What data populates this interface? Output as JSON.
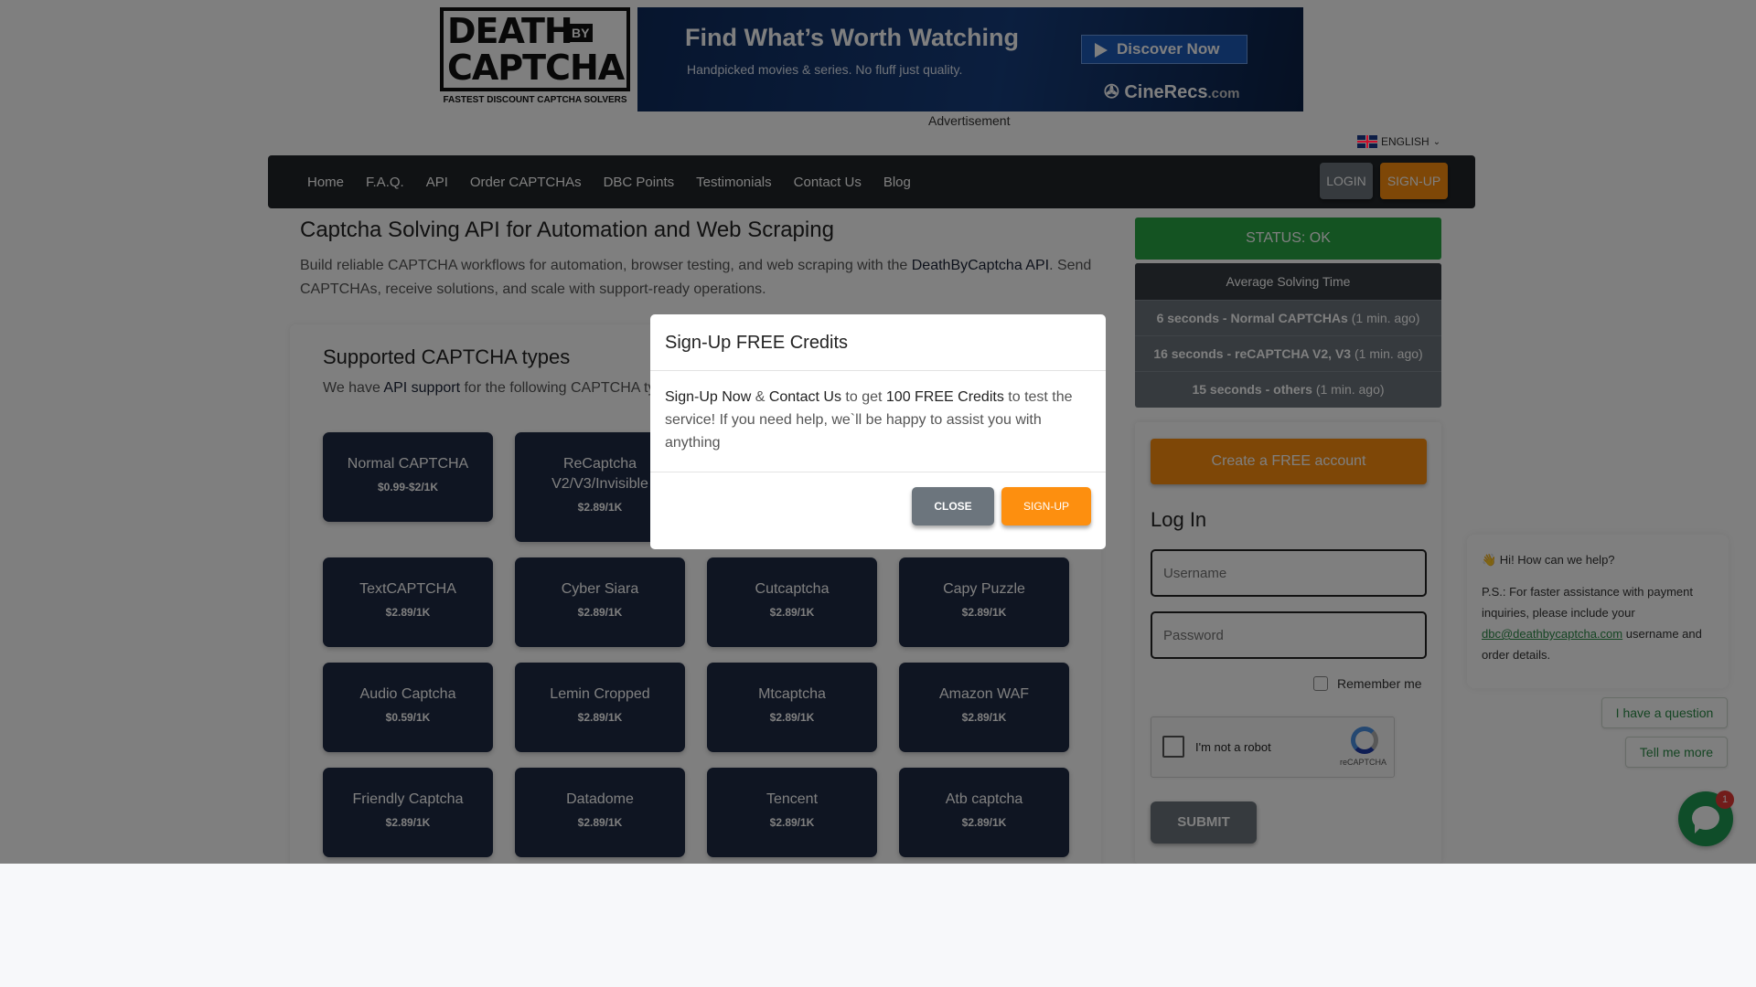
{
  "header": {
    "logo": {
      "line1": "DEATH",
      "by": "BY",
      "line2": "CAPTCHA",
      "tagline": "FASTEST DISCOUNT CAPTCHA SOLVERS"
    },
    "ad": {
      "headline": "Find What’s Worth Watching",
      "sub": "Handpicked movies & series. No fluff just quality.",
      "button": "Discover Now",
      "brand": "CineRecs",
      "brand_suffix": ".com",
      "label": "Advertisement"
    },
    "language": "ENGLISH"
  },
  "nav": {
    "items": [
      "Home",
      "F.A.Q.",
      "API",
      "Order CAPTCHAs",
      "DBC Points",
      "Testimonials",
      "Contact Us",
      "Blog"
    ],
    "login": "LOGIN",
    "signup": "SIGN-UP"
  },
  "main": {
    "title": "Captcha Solving API for Automation and Web Scraping",
    "intro_pre": "Build reliable CAPTCHA workflows for automation, browser testing, and web scraping with the ",
    "intro_link": "DeathByCaptcha API",
    "intro_post": ". Send CAPTCHAs, receive solutions, and scale with support-ready operations.",
    "types_title": "Supported CAPTCHA types",
    "types_sub_pre": "We have ",
    "types_sub_link": "API support",
    "types_sub_post": " for the following CAPTCHA ty",
    "tiles": [
      {
        "name": "Normal CAPTCHA",
        "price": "$0.99-$2/1K"
      },
      {
        "name": "ReCaptcha V2/V3/Invisible",
        "price": "$2.89/1K"
      },
      {
        "name": "TextCAPTCHA",
        "price": "$2.89/1K"
      },
      {
        "name": "Cyber Siara",
        "price": "$2.89/1K"
      },
      {
        "name": "Cutcaptcha",
        "price": "$2.89/1K"
      },
      {
        "name": "Capy Puzzle",
        "price": "$2.89/1K"
      },
      {
        "name": "Audio Captcha",
        "price": "$0.59/1K"
      },
      {
        "name": "Lemin Cropped",
        "price": "$2.89/1K"
      },
      {
        "name": "Mtcaptcha",
        "price": "$2.89/1K"
      },
      {
        "name": "Amazon WAF",
        "price": "$2.89/1K"
      },
      {
        "name": "Friendly Captcha",
        "price": "$2.89/1K"
      },
      {
        "name": "Datadome",
        "price": "$2.89/1K"
      },
      {
        "name": "Tencent",
        "price": "$2.89/1K"
      },
      {
        "name": "Atb captcha",
        "price": "$2.89/1K"
      }
    ]
  },
  "sidebar": {
    "status": "STATUS: OK",
    "avg_title": "Average Solving Time",
    "avg_rows": [
      {
        "label": "6 seconds - Normal CAPTCHAs",
        "ago": "(1 min. ago)"
      },
      {
        "label": "16 seconds - reCAPTCHA V2, V3",
        "ago": "(1 min. ago)"
      },
      {
        "label": "15 seconds - others",
        "ago": "(1 min. ago)"
      }
    ],
    "create_account": "Create a FREE account",
    "login_title": "Log In",
    "username_placeholder": "Username",
    "password_placeholder": "Password",
    "remember": "Remember me",
    "recaptcha_text": "I'm not a robot",
    "recaptcha_label": "reCAPTCHA",
    "submit": "SUBMIT"
  },
  "chat": {
    "greeting": "👋 Hi! How can we help?",
    "ps_pre": "P.S.: For faster assistance with payment inquiries, please include your ",
    "ps_mail": "dbc@deathbycaptcha.com",
    "ps_post": " username and order details.",
    "quick1": "I have a question",
    "quick2": "Tell me more",
    "badge": "1"
  },
  "modal": {
    "title": "Sign-Up FREE Credits",
    "body_link1": "Sign-Up Now",
    "body_amp": " & ",
    "body_link2": "Contact Us",
    "body_mid": " to get ",
    "body_credits": "100 FREE Credits",
    "body_post": " to test the service! If you need help, we`ll be happy to assist you with anything",
    "close": "CLOSE",
    "signup": "SIGN-UP"
  },
  "colors": {
    "accent": "#fd8f0f",
    "status_ok": "#28a745",
    "tile": "#1f2a44",
    "navbar": "#212529",
    "chat": "#1f9a52"
  }
}
